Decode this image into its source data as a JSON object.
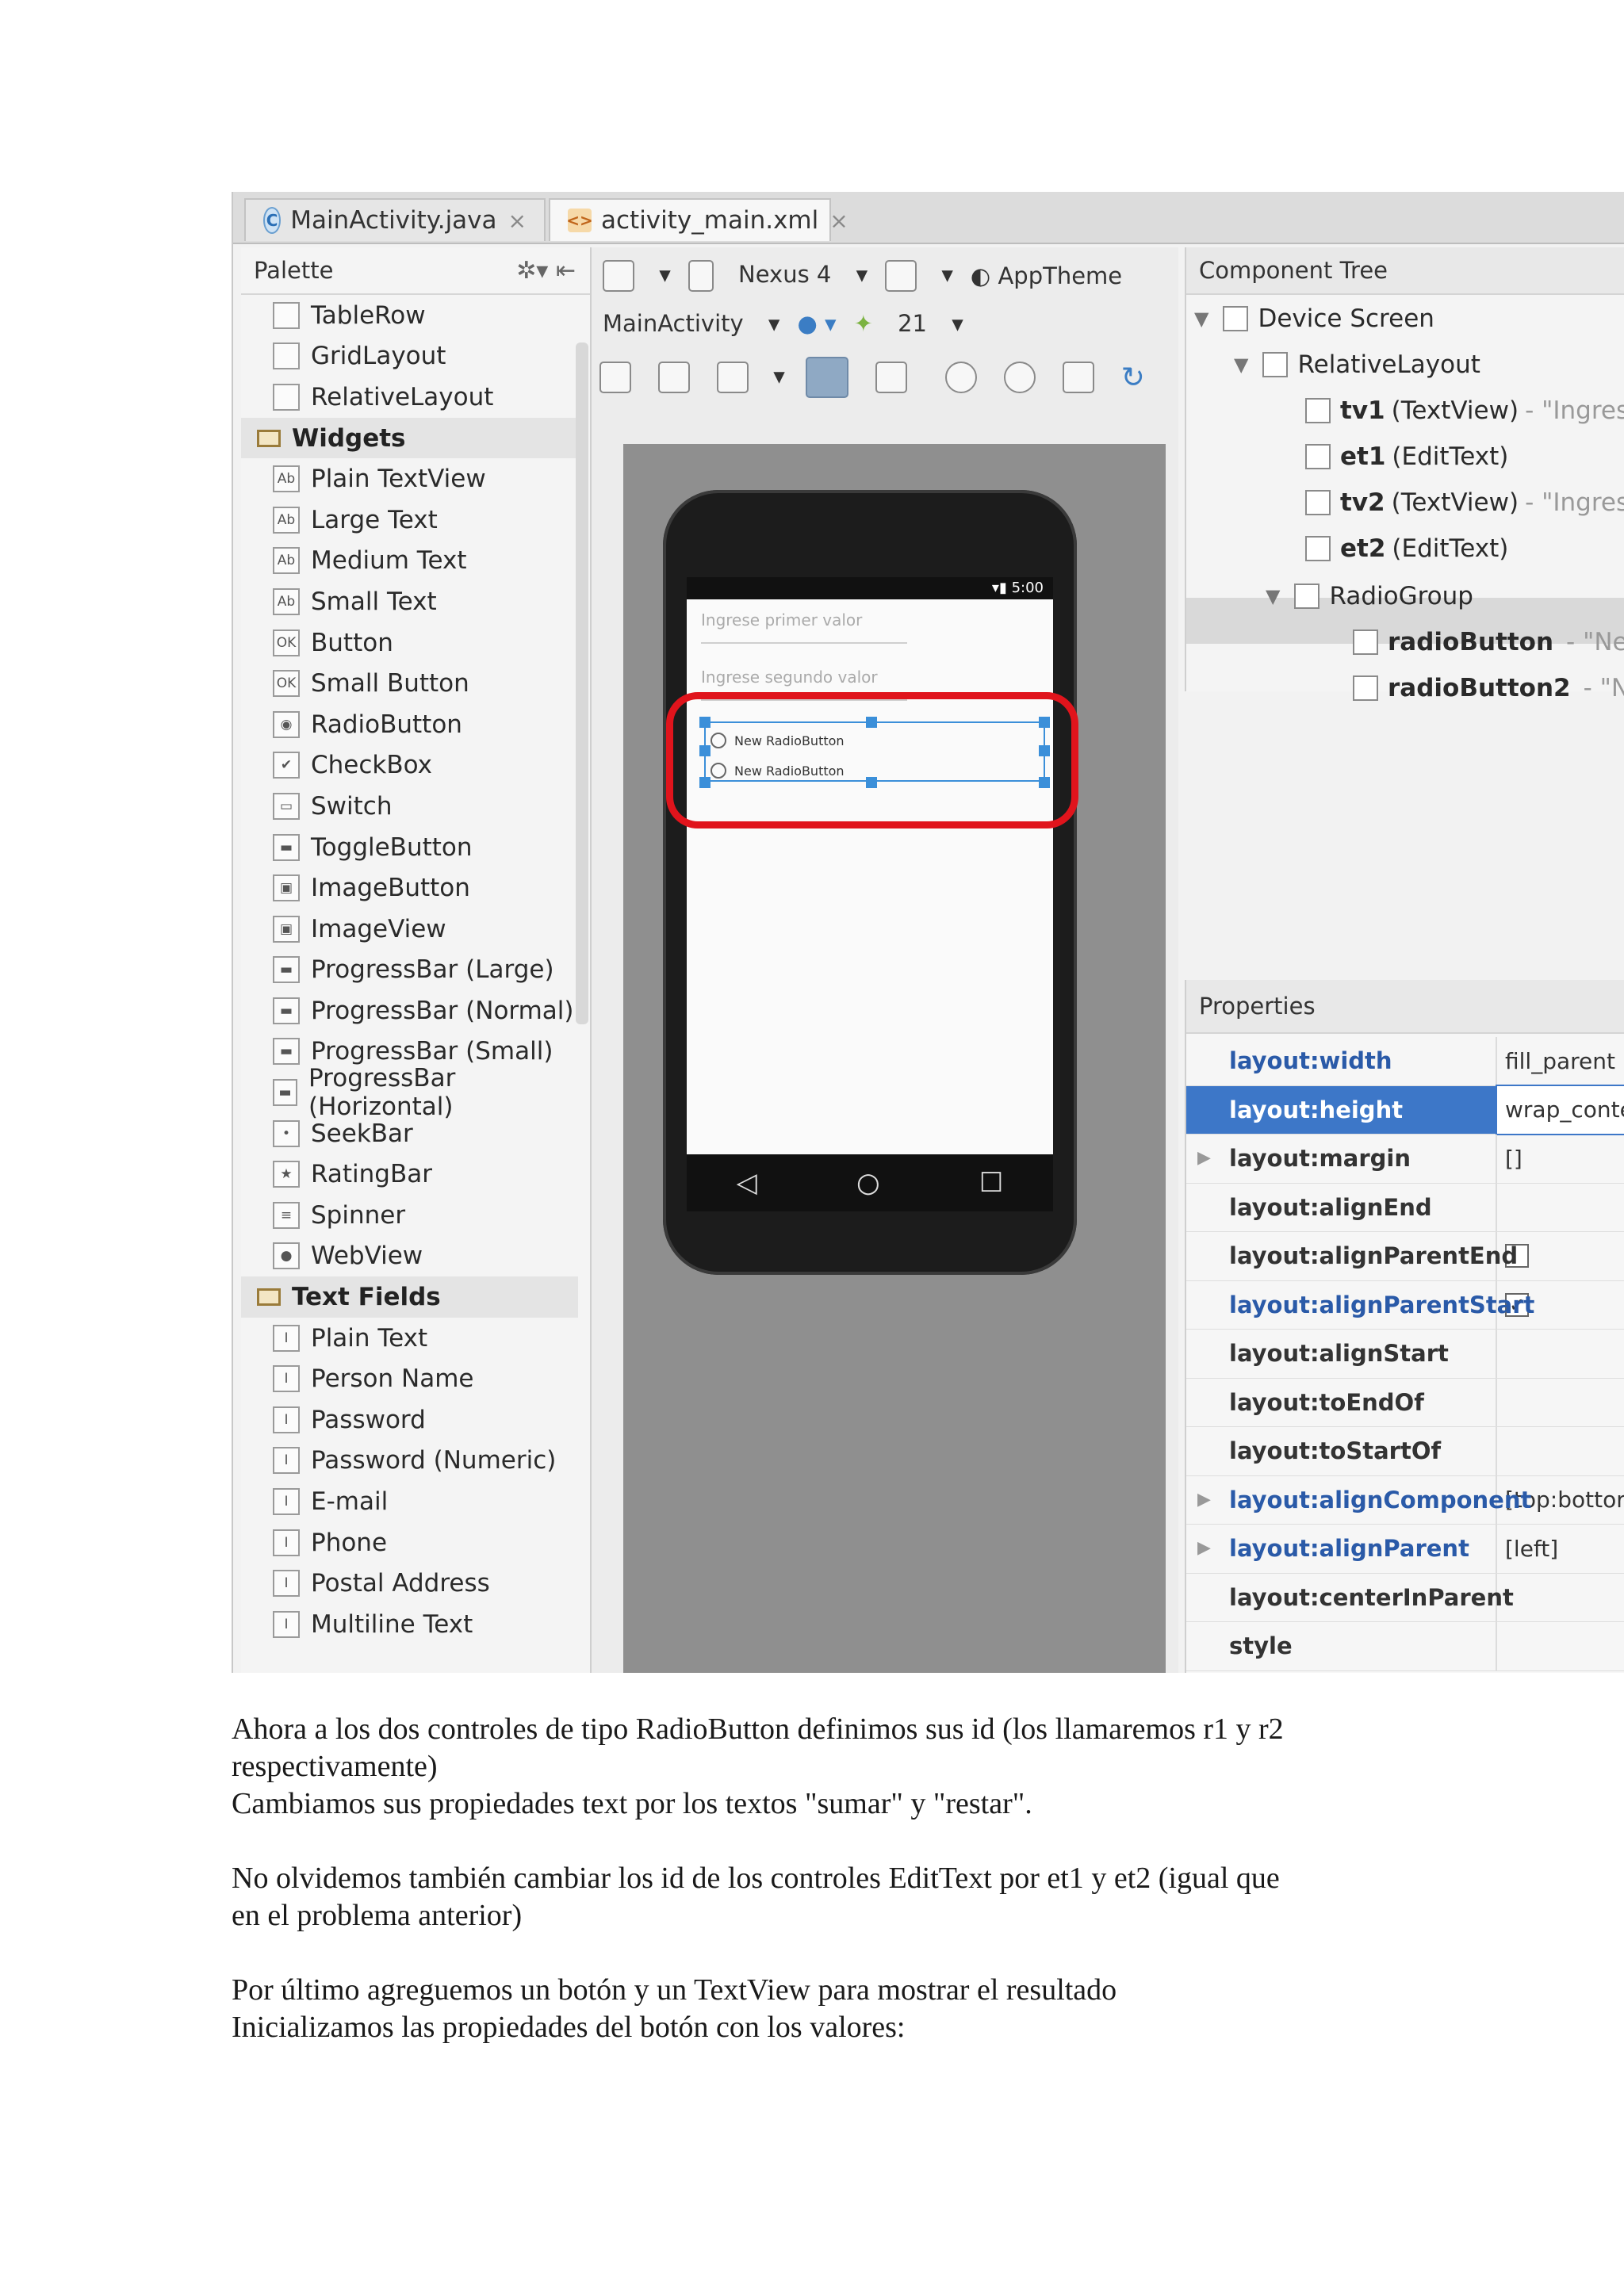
{
  "tabs": [
    {
      "label": "MainActivity.java",
      "icon": "java-class-icon",
      "close": "×"
    },
    {
      "label": "activity_main.xml",
      "icon": "xml-file-icon",
      "close": "×"
    }
  ],
  "palette": {
    "title": "Palette",
    "items": [
      {
        "type": "item",
        "label": "TableRow",
        "icon": "table-icon"
      },
      {
        "type": "item",
        "label": "GridLayout",
        "icon": "grid-icon"
      },
      {
        "type": "item",
        "label": "RelativeLayout",
        "icon": "relative-layout-icon"
      },
      {
        "type": "cat",
        "label": "Widgets"
      },
      {
        "type": "item",
        "label": "Plain TextView",
        "icon": "textview-icon",
        "glyph": "Ab"
      },
      {
        "type": "item",
        "label": "Large Text",
        "icon": "textview-icon",
        "glyph": "Ab"
      },
      {
        "type": "item",
        "label": "Medium Text",
        "icon": "textview-icon",
        "glyph": "Ab"
      },
      {
        "type": "item",
        "label": "Small Text",
        "icon": "textview-icon",
        "glyph": "Ab"
      },
      {
        "type": "item",
        "label": "Button",
        "icon": "button-icon",
        "glyph": "OK"
      },
      {
        "type": "item",
        "label": "Small Button",
        "icon": "button-icon",
        "glyph": "OK"
      },
      {
        "type": "item",
        "label": "RadioButton",
        "icon": "radio-icon",
        "glyph": "◉"
      },
      {
        "type": "item",
        "label": "CheckBox",
        "icon": "checkbox-icon",
        "glyph": "✔"
      },
      {
        "type": "item",
        "label": "Switch",
        "icon": "switch-icon",
        "glyph": "▭"
      },
      {
        "type": "item",
        "label": "ToggleButton",
        "icon": "toggle-icon",
        "glyph": "▬"
      },
      {
        "type": "item",
        "label": "ImageButton",
        "icon": "image-button-icon",
        "glyph": "▣"
      },
      {
        "type": "item",
        "label": "ImageView",
        "icon": "image-view-icon",
        "glyph": "▣"
      },
      {
        "type": "item",
        "label": "ProgressBar (Large)",
        "icon": "progress-icon",
        "glyph": "▬"
      },
      {
        "type": "item",
        "label": "ProgressBar (Normal)",
        "icon": "progress-icon",
        "glyph": "▬"
      },
      {
        "type": "item",
        "label": "ProgressBar (Small)",
        "icon": "progress-icon",
        "glyph": "▬"
      },
      {
        "type": "item",
        "label": "ProgressBar (Horizontal)",
        "icon": "progress-icon",
        "glyph": "▬"
      },
      {
        "type": "item",
        "label": "SeekBar",
        "icon": "seekbar-icon",
        "glyph": "•"
      },
      {
        "type": "item",
        "label": "RatingBar",
        "icon": "star-icon",
        "glyph": "★"
      },
      {
        "type": "item",
        "label": "Spinner",
        "icon": "spinner-icon",
        "glyph": "≡"
      },
      {
        "type": "item",
        "label": "WebView",
        "icon": "globe-icon",
        "glyph": "●"
      },
      {
        "type": "cat",
        "label": "Text Fields"
      },
      {
        "type": "item",
        "label": "Plain Text",
        "icon": "text-field-icon",
        "glyph": "I"
      },
      {
        "type": "item",
        "label": "Person Name",
        "icon": "text-field-icon",
        "glyph": "I"
      },
      {
        "type": "item",
        "label": "Password",
        "icon": "text-field-icon",
        "glyph": "I"
      },
      {
        "type": "item",
        "label": "Password (Numeric)",
        "icon": "text-field-icon",
        "glyph": "I"
      },
      {
        "type": "item",
        "label": "E-mail",
        "icon": "text-field-icon",
        "glyph": "I"
      },
      {
        "type": "item",
        "label": "Phone",
        "icon": "text-field-icon",
        "glyph": "I"
      },
      {
        "type": "item",
        "label": "Postal Address",
        "icon": "text-field-icon",
        "glyph": "I"
      },
      {
        "type": "item",
        "label": "Multiline Text",
        "icon": "text-field-icon",
        "glyph": "I"
      }
    ]
  },
  "designer": {
    "device": "Nexus 4",
    "theme": "AppTheme",
    "activity": "MainActivity",
    "api": "21",
    "phone": {
      "time": "5:00",
      "hint1": "Ingrese primer valor",
      "hint2": "Ingrese segundo valor",
      "radio1": "New RadioButton",
      "radio2": "New RadioButton",
      "nav": [
        "◁",
        "○",
        "☐"
      ]
    },
    "highlight_color": "#e0141c",
    "selection_color": "#3b8fd9"
  },
  "component_tree": {
    "title": "Component Tree",
    "nodes": [
      {
        "bold": "",
        "label": "Device Screen",
        "extra": "",
        "icon": "device-icon"
      },
      {
        "bold": "",
        "label": "RelativeLayout",
        "extra": "",
        "icon": "relative-layout-icon"
      },
      {
        "bold": "tv1",
        "label": "(TextView)",
        "extra": "- \"Ingrese",
        "icon": "textview-icon"
      },
      {
        "bold": "et1",
        "label": "(EditText)",
        "extra": "",
        "icon": "edittext-icon"
      },
      {
        "bold": "tv2",
        "label": "(TextView)",
        "extra": "- \"Ingrese",
        "icon": "textview-icon"
      },
      {
        "bold": "et2",
        "label": "(EditText)",
        "extra": "",
        "icon": "edittext-icon"
      },
      {
        "bold": "",
        "label": "RadioGroup",
        "extra": "",
        "icon": "radiogroup-icon"
      },
      {
        "bold": "radioButton",
        "label": "",
        "extra": "- \"New R",
        "icon": "radio-icon"
      },
      {
        "bold": "radioButton2",
        "label": "",
        "extra": "- \"New",
        "icon": "radio-icon"
      }
    ]
  },
  "properties": {
    "title": "Properties",
    "rows": [
      {
        "name": "layout:width",
        "value": "fill_parent",
        "blue": true
      },
      {
        "name": "layout:height",
        "value": "wrap_conte",
        "blue": true,
        "selected": true
      },
      {
        "name": "layout:margin",
        "value": "[]",
        "expand": true
      },
      {
        "name": "layout:alignEnd",
        "value": ""
      },
      {
        "name": "layout:alignParentEnd",
        "value": "",
        "checkbox": "unchecked"
      },
      {
        "name": "layout:alignParentStart",
        "value": "",
        "checkbox": "checked",
        "blue": true
      },
      {
        "name": "layout:alignStart",
        "value": ""
      },
      {
        "name": "layout:toEndOf",
        "value": ""
      },
      {
        "name": "layout:toStartOf",
        "value": ""
      },
      {
        "name": "layout:alignComponent",
        "value": "[top:bottor",
        "expand": true,
        "blue": true
      },
      {
        "name": "layout:alignParent",
        "value": "[left]",
        "expand": true,
        "blue": true
      },
      {
        "name": "layout:centerInParent",
        "value": ""
      },
      {
        "name": "style",
        "value": ""
      }
    ]
  },
  "document": {
    "p1_line1": "Ahora a los dos controles de tipo RadioButton definimos sus id (los llamaremos r1 y r2",
    "p1_line2": "respectivamente)",
    "p1_line3": "Cambiamos sus propiedades text por los textos \"sumar\" y \"restar\".",
    "p2_line1": "No olvidemos también cambiar los id de los controles EditText por et1 y et2 (igual que",
    "p2_line2": "en el problema anterior)",
    "p3_line1": "Por último agreguemos un botón y un TextView para mostrar el resultado",
    "p3_line2": "Inicializamos las propiedades del botón con los valores:"
  }
}
